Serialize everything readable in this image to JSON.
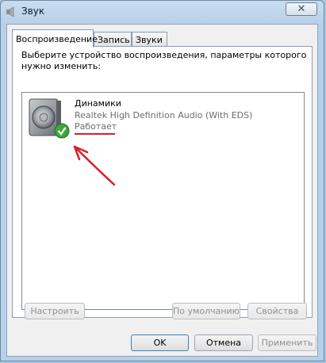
{
  "window": {
    "title": "Звук",
    "close_label": "✕"
  },
  "tabs": [
    {
      "label": "Воспроизведение"
    },
    {
      "label": "Запись"
    },
    {
      "label": "Звуки"
    }
  ],
  "panel": {
    "instruction": "Выберите устройство воспроизведения, параметры которого нужно изменить:"
  },
  "device": {
    "name": "Динамики",
    "description": "Realtek High Definition Audio (With EDS)",
    "status": "Работает"
  },
  "panel_buttons": {
    "configure": "Настроить",
    "set_default": "По умолчанию",
    "properties": "Свойства"
  },
  "dialog_buttons": {
    "ok": "OK",
    "cancel": "Отмена",
    "apply": "Применить"
  },
  "colors": {
    "annotation": "#d8202a",
    "check": "#3aa83a"
  }
}
